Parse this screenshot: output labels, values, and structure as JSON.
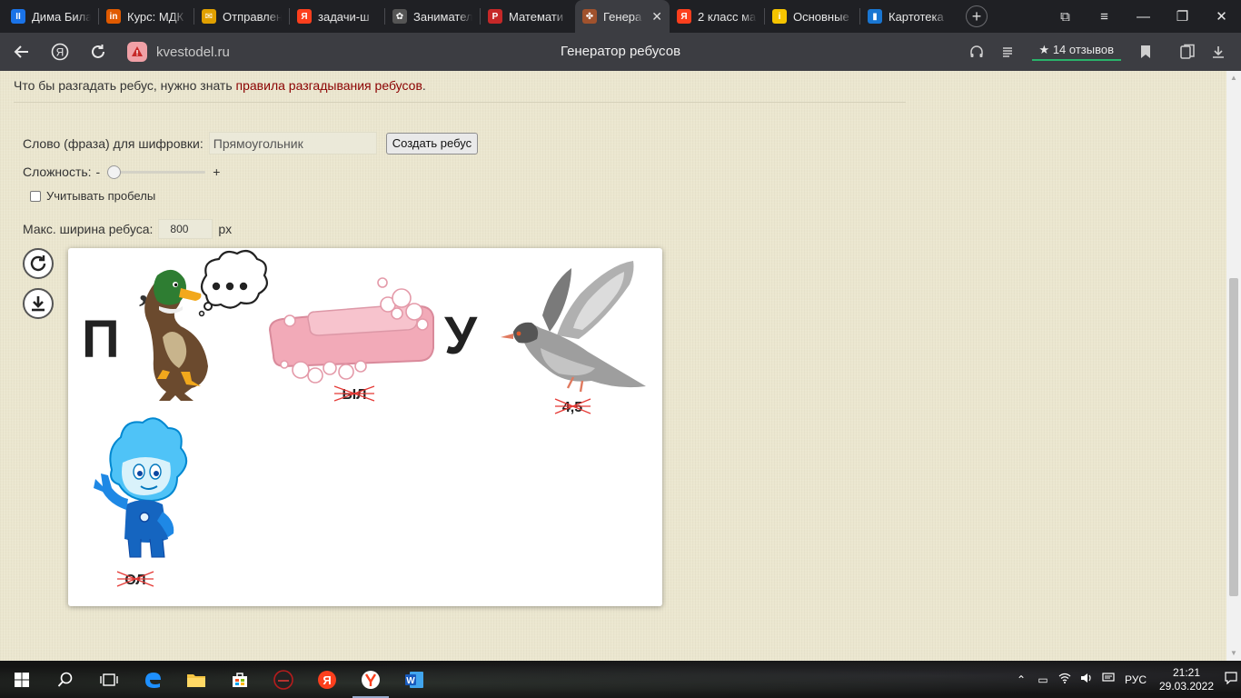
{
  "tabs": [
    {
      "title": "Дима Била",
      "fav_color": "#1a73e8",
      "fav_char": "II"
    },
    {
      "title": "Курс: МДК",
      "fav_color": "#e05a00",
      "fav_char": "in"
    },
    {
      "title": "Отправлен",
      "fav_color": "#e0a000",
      "fav_char": "✉"
    },
    {
      "title": "задачи-ш",
      "fav_color": "#fc3f1d",
      "fav_char": "Я"
    },
    {
      "title": "Заниматель",
      "fav_color": "#555555",
      "fav_char": "✿"
    },
    {
      "title": "Математи",
      "fav_color": "#c62828",
      "fav_char": "P"
    },
    {
      "title": "Генера",
      "fav_color": "#a0522d",
      "fav_char": "✤",
      "active": true
    },
    {
      "title": "2 класс ма",
      "fav_color": "#fc3f1d",
      "fav_char": "Я"
    },
    {
      "title": "Основные",
      "fav_color": "#f5c400",
      "fav_char": "i"
    },
    {
      "title": "Картотека",
      "fav_color": "#1976d2",
      "fav_char": "▮"
    }
  ],
  "address": {
    "domain": "kvestodel.ru",
    "page_title": "Генератор ребусов",
    "reviews": "14 отзывов"
  },
  "page": {
    "intro_text": "Что бы разгадать ребус, нужно знать",
    "intro_link": "правила разгадывания ребусов",
    "intro_end": ".",
    "word_label": "Слово (фраза) для шифровки:",
    "word_value": "Прямоугольник",
    "create_button": "Создать ребус",
    "difficulty_label": "Сложность:",
    "minus": "-",
    "plus": "+",
    "difficulty_level": 0,
    "spaces_label": "Учитывать пробелы",
    "width_label": "Макс. ширина ребуса:",
    "width_value": "800",
    "width_unit": "px"
  },
  "rebus": {
    "letter_p": "П",
    "letter_u": "У",
    "comma": ",",
    "soap_strike": "ЫЛ",
    "dove_strike": "4,5",
    "fixie_strike": "ОЛ"
  },
  "taskbar": {
    "language": "РУС",
    "time": "21:21",
    "date": "29.03.2022"
  }
}
